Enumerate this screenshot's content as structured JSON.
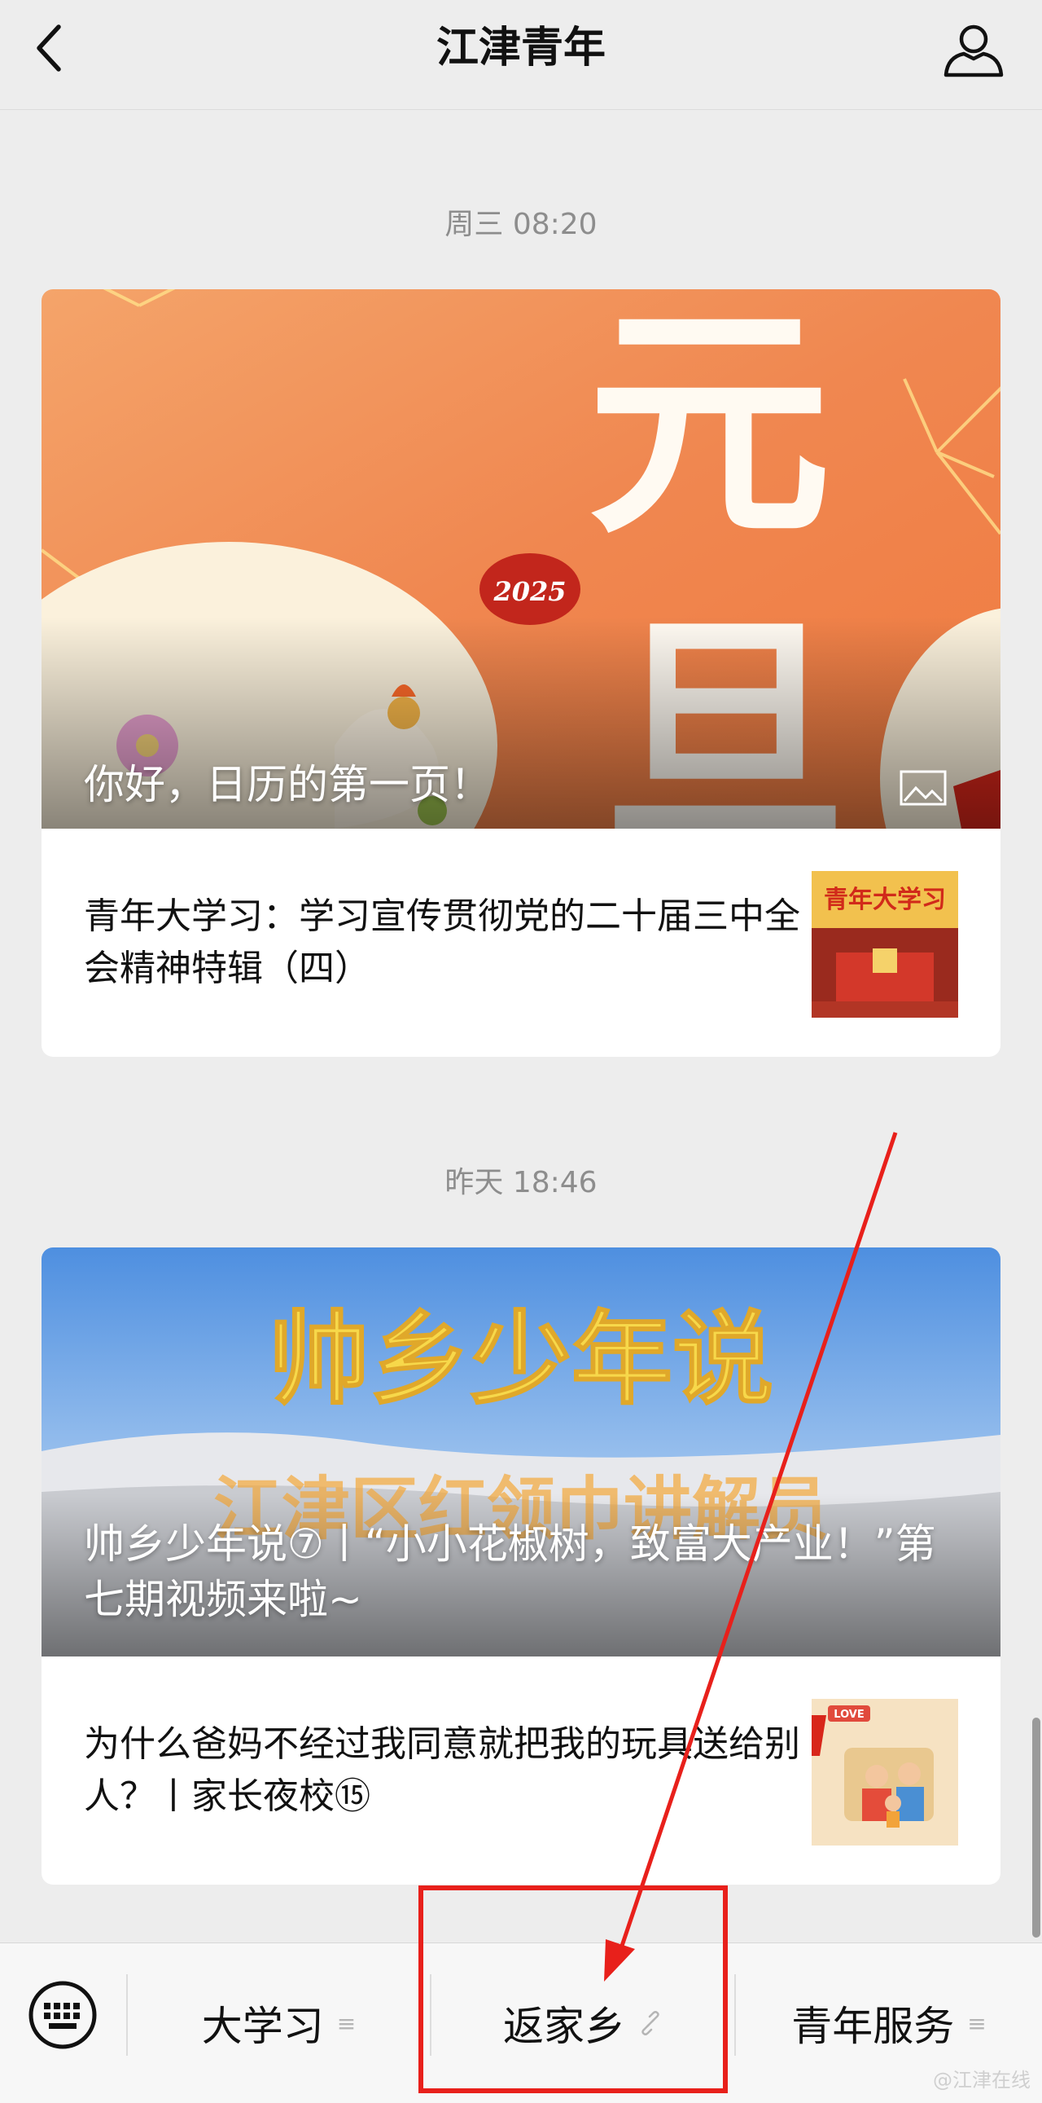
{
  "header": {
    "title": "江津青年"
  },
  "messages": [
    {
      "timestamp": "周三 08:20",
      "hero_caption": "你好，日历的第一页！",
      "hero_art": {
        "line1": "元",
        "line2": "旦",
        "seal": "2025"
      },
      "item_title": "青年大学习：学习宣传贯彻党的二十届三中全会精神特辑（四）",
      "thumb_text": "青年大学习"
    },
    {
      "timestamp": "昨天 18:46",
      "hero_caption": "帅乡少年说⑦丨“小小花椒树，致富大产业！”第七期视频来啦~",
      "hero_art": {
        "title": "帅乡少年说",
        "subtitle": "江津区红领巾讲解员"
      },
      "item_title": "为什么爸妈不经过我同意就把我的玩具送给别人？丨家长夜校⑮",
      "thumb_text": "LOVE"
    }
  ],
  "bottom_menu": {
    "items": [
      {
        "label": "大学习",
        "icon": "menu-lines-icon"
      },
      {
        "label": "返家乡",
        "icon": "link-icon"
      },
      {
        "label": "青年服务",
        "icon": "menu-lines-icon"
      }
    ]
  },
  "watermark": "@江津在线",
  "colors": {
    "background": "#ededed",
    "annotation": "#e8201b"
  }
}
